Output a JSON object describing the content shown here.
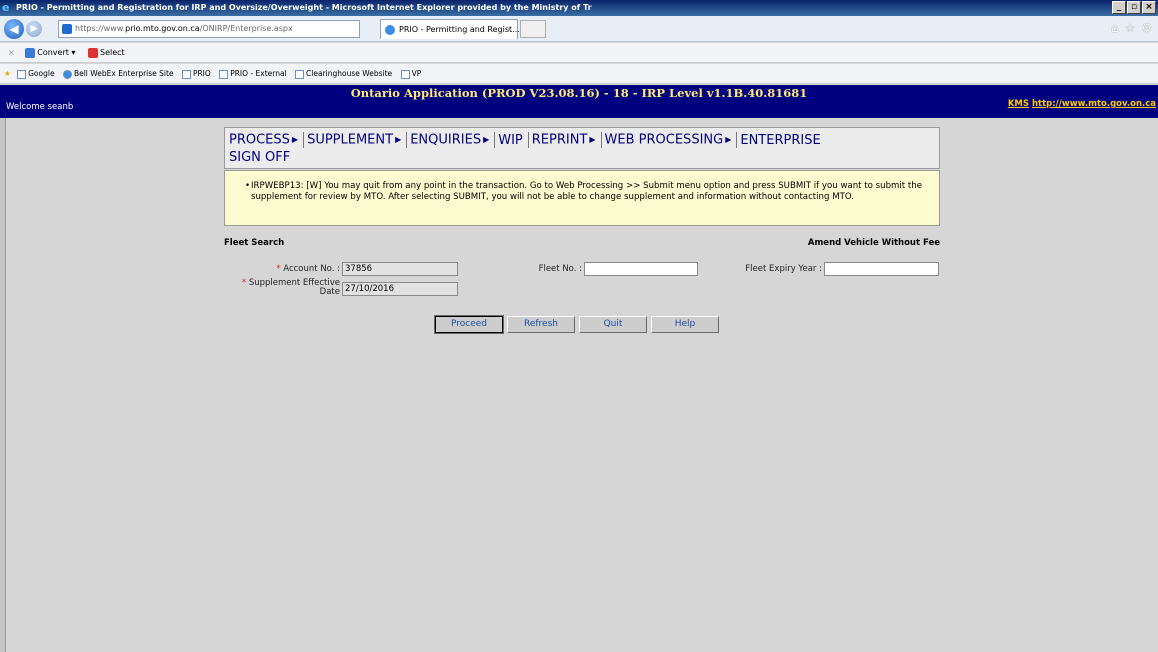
{
  "window": {
    "title": "PRIO - Permitting and Registration for IRP and Oversize/Overweight - Microsoft Internet Explorer provided by the Ministry of Tr"
  },
  "browser": {
    "url_prefix": "https://www.",
    "url_domain": "prio.mto.gov.on.ca",
    "url_path": "/ONIRP/Enterprise.aspx",
    "tab_title": "PRIO - Permitting and Regist...",
    "commands": {
      "convert": "Convert",
      "select": "Select"
    },
    "favorites": [
      "Google",
      "Bell WebEx Enterprise Site",
      "PRIO",
      "PRIO - External",
      "Clearinghouse Website",
      "VP"
    ]
  },
  "header": {
    "welcome": "Welcome seanb",
    "app_title": "Ontario Application (PROD V23.08.16) - 18 - IRP Level v1.1B.40.81681",
    "kms_label": "KMS",
    "kms_url": "http://www.mto.gov.on.ca"
  },
  "menu": {
    "row1": [
      {
        "label": "PROCESS",
        "has_submenu": true
      },
      {
        "label": "SUPPLEMENT",
        "has_submenu": true
      },
      {
        "label": "ENQUIRIES",
        "has_submenu": true
      },
      {
        "label": "WIP",
        "has_submenu": false
      },
      {
        "label": "REPRINT",
        "has_submenu": true
      },
      {
        "label": "WEB PROCESSING",
        "has_submenu": true
      },
      {
        "label": "ENTERPRISE",
        "has_submenu": false
      }
    ],
    "row2": [
      {
        "label": "SIGN OFF",
        "has_submenu": false
      }
    ]
  },
  "message": {
    "text": "IRPWEBP13: [W] You may quit from any point in the transaction. Go to Web Processing >> Submit menu option and press SUBMIT if you want to submit the supplement for review by MTO. After selecting SUBMIT, you will not be able to change supplement and information without contacting MTO."
  },
  "form": {
    "section_title": "Fleet Search",
    "action_title": "Amend Vehicle Without Fee",
    "account_no": {
      "label": "Account No. :",
      "value": "37856"
    },
    "supp_eff_date": {
      "label_line1": "Supplement Effective",
      "label_line2": "Date",
      "value": "27/10/2016"
    },
    "fleet_no": {
      "label": "Fleet No. :",
      "value": ""
    },
    "fleet_expiry_year": {
      "label": "Fleet Expiry Year :",
      "value": ""
    }
  },
  "buttons": {
    "proceed": "Proceed",
    "refresh": "Refresh",
    "quit": "Quit",
    "help": "Help"
  }
}
